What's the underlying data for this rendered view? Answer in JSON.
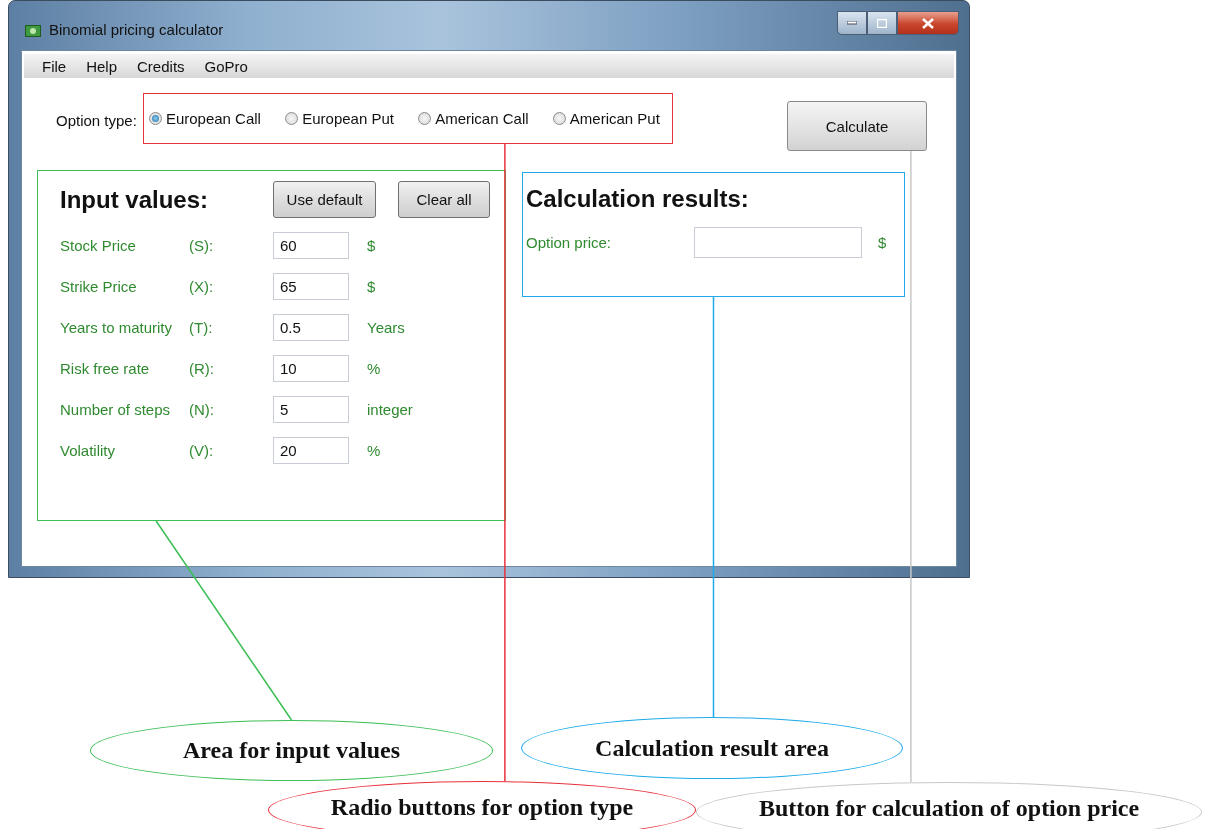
{
  "window": {
    "title": "Binomial pricing calculator"
  },
  "menu": [
    "File",
    "Help",
    "Credits",
    "GoPro"
  ],
  "option_type": {
    "label": "Option type:",
    "options": [
      {
        "label": "European Call",
        "selected": true
      },
      {
        "label": "European Put",
        "selected": false
      },
      {
        "label": "American Call",
        "selected": false
      },
      {
        "label": "American Put",
        "selected": false
      }
    ]
  },
  "calculate_button": "Calculate",
  "inputs": {
    "title": "Input values:",
    "buttons": [
      "Use default",
      "Clear all"
    ],
    "fields": [
      {
        "label": "Stock Price",
        "symbol": "(S):",
        "value": "60",
        "unit": "$"
      },
      {
        "label": "Strike Price",
        "symbol": "(X):",
        "value": "65",
        "unit": "$"
      },
      {
        "label": "Years to maturity",
        "symbol": "(T):",
        "value": "0.5",
        "unit": "Years"
      },
      {
        "label": "Risk free rate",
        "symbol": "(R):",
        "value": "10",
        "unit": "%"
      },
      {
        "label": "Number of steps",
        "symbol": "(N):",
        "value": "5",
        "unit": "integer"
      },
      {
        "label": "Volatility",
        "symbol": "(V):",
        "value": "20",
        "unit": "%"
      }
    ]
  },
  "results": {
    "title": "Calculation results:",
    "fields": [
      {
        "label": "Option price:",
        "unit": "$"
      }
    ]
  },
  "callouts": [
    {
      "text": "Area for input values",
      "color": "#3cbf55",
      "kind": "inputs"
    },
    {
      "text": "Calculation result area",
      "color": "#1eaaea",
      "kind": "results"
    },
    {
      "text": "Radio buttons for option type",
      "color": "#e8323c",
      "kind": "option_type"
    },
    {
      "text": "Button for calculation of option price",
      "color": "#c8c8c8",
      "kind": "calculate"
    }
  ]
}
